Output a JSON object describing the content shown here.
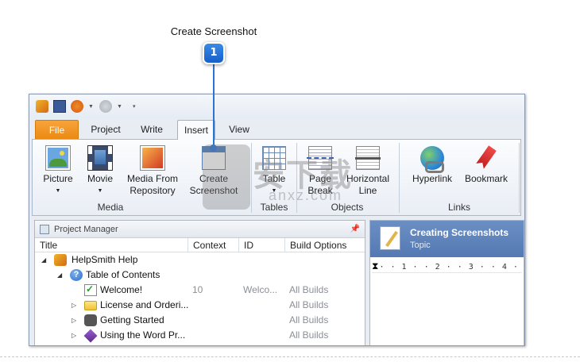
{
  "callout": {
    "title": "Create Screenshot",
    "number": "1"
  },
  "qat": {
    "items": [
      "app-icon",
      "save-icon",
      "back-icon",
      "forward-icon",
      "customize-icon"
    ]
  },
  "tabs": [
    {
      "label": "File"
    },
    {
      "label": "Project"
    },
    {
      "label": "Write"
    },
    {
      "label": "Insert",
      "active": true
    },
    {
      "label": "View"
    }
  ],
  "ribbon": {
    "media": {
      "group_label": "Media",
      "picture": "Picture",
      "movie": "Movie",
      "media_from_repo_1": "Media From",
      "media_from_repo_2": "Repository"
    },
    "screenshot": {
      "label_1": "Create",
      "label_2": "Screenshot"
    },
    "tables": {
      "group_label": "Tables",
      "table": "Table"
    },
    "objects": {
      "group_label": "Objects",
      "page_break_1": "Page",
      "page_break_2": "Break",
      "hline_1": "Horizontal",
      "hline_2": "Line"
    },
    "links": {
      "group_label": "Links",
      "hyperlink": "Hyperlink",
      "bookmark": "Bookmark"
    }
  },
  "project_manager": {
    "title": "Project Manager",
    "columns": [
      "Title",
      "Context",
      "ID",
      "Build Options"
    ],
    "rows": [
      {
        "title": "HelpSmith Help",
        "context": "",
        "id": "",
        "build": ""
      },
      {
        "title": "Table of Contents",
        "context": "",
        "id": "",
        "build": ""
      },
      {
        "title": "Welcome!",
        "context": "10",
        "id": "Welco...",
        "build": "All Builds"
      },
      {
        "title": "License and Orderi...",
        "context": "",
        "id": "",
        "build": "All Builds"
      },
      {
        "title": "Getting Started",
        "context": "",
        "id": "",
        "build": "All Builds"
      },
      {
        "title": "Using the Word Pr...",
        "context": "",
        "id": "",
        "build": "All Builds"
      }
    ]
  },
  "topic": {
    "title": "Creating Screenshots",
    "subtitle": "Topic",
    "ruler": "·  ·  1  ·  ·  2  ·  ·  3  ·  ·  4  ·"
  },
  "watermark": {
    "text": "安下载",
    "sub": "anxz.com"
  }
}
